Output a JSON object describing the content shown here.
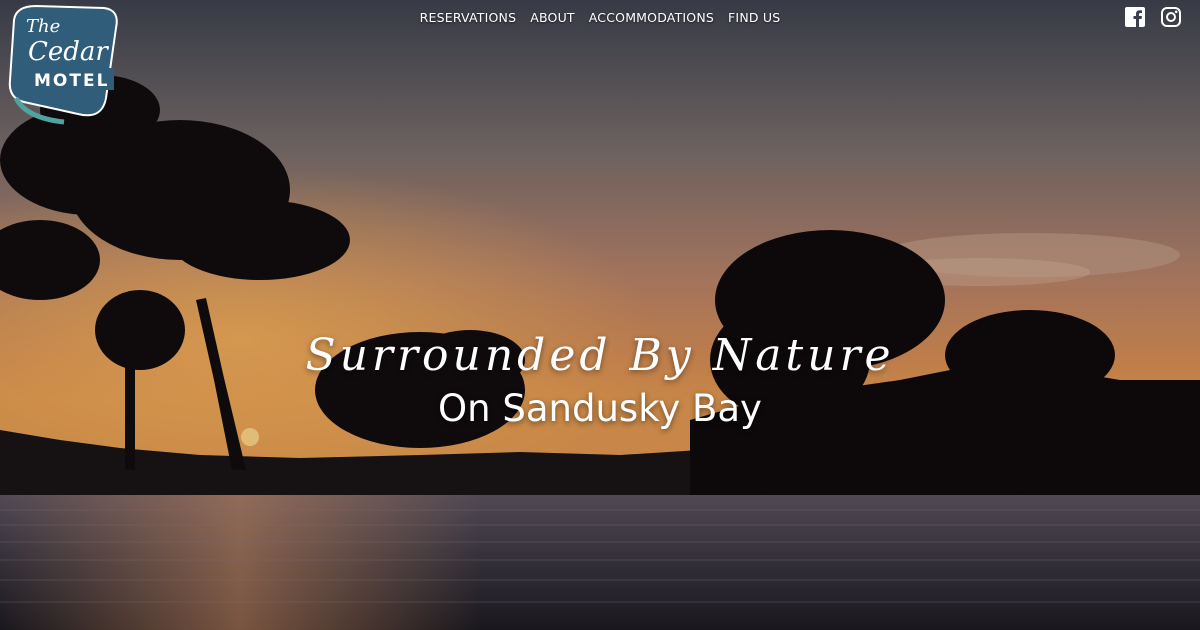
{
  "brand": {
    "logo_line1": "The",
    "logo_line2": "Cedar",
    "logo_line3": "MOTEL",
    "colors": {
      "badge": "#2f5d7a",
      "accent": "#4fa3a0"
    }
  },
  "nav": {
    "items": [
      {
        "label": "RESERVATIONS"
      },
      {
        "label": "ABOUT"
      },
      {
        "label": "ACCOMMODATIONS"
      },
      {
        "label": "FIND US"
      }
    ]
  },
  "social": {
    "icons": [
      "facebook-icon",
      "instagram-icon"
    ]
  },
  "hero": {
    "script_line": "Surrounded By Nature",
    "sub_line": "On Sandusky Bay"
  }
}
